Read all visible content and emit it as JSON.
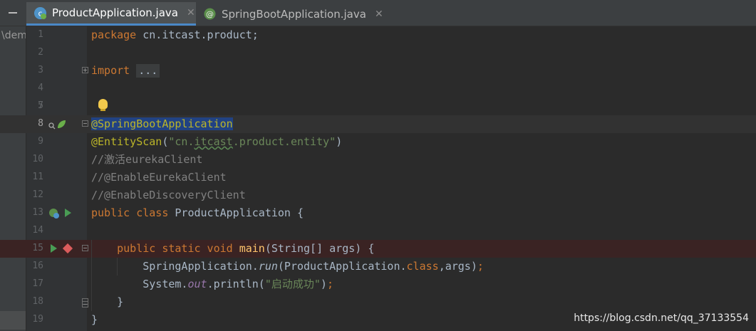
{
  "tabs": [
    {
      "label": "ProductApplication.java",
      "close": "✕",
      "icon": "spring-class-icon"
    },
    {
      "label": "SpringBootApplication.java",
      "close": "✕",
      "icon": "annotation-icon"
    }
  ],
  "sidebar": {
    "path_label": "\\dem"
  },
  "lines": [
    {
      "num": "1"
    },
    {
      "num": "2"
    },
    {
      "num": "3"
    },
    {
      "num": "4"
    },
    {
      "num": "5"
    },
    {
      "num": "6"
    },
    {
      "num": "7"
    },
    {
      "num": "8"
    },
    {
      "num": "9"
    },
    {
      "num": "10"
    },
    {
      "num": "11"
    },
    {
      "num": "12"
    },
    {
      "num": "13"
    },
    {
      "num": "14"
    },
    {
      "num": "15"
    },
    {
      "num": "16"
    },
    {
      "num": "17"
    },
    {
      "num": "18"
    },
    {
      "num": "19"
    }
  ],
  "code": {
    "l1_kw": "package",
    "l1_rest": " cn.itcast.product;",
    "l3_kw": "import",
    "l3_fold": "...",
    "l8_ann": "@SpringBootApplication",
    "l9_ann": "@EntityScan",
    "l9_p1": "(",
    "l9_str_a": "\"cn.",
    "l9_str_b": "itcast",
    "l9_str_c": ".product.entity\"",
    "l9_p2": ")",
    "l10": "//激活eurekaClient",
    "l11": "//@EnableEurekaClient",
    "l12": "//@EnableDiscoveryClient",
    "l13_kw": "public class",
    "l13_rest": " ProductApplication {",
    "l15_kw": "public static void",
    "l15_mth": "main",
    "l15_rest": "(String[] args) {",
    "l16_a": "SpringApplication.",
    "l16_run": "run",
    "l16_b": "(ProductApplication.",
    "l16_cls": "class",
    "l16_c": ",args)",
    "l16_semi": ";",
    "l17_a": "System.",
    "l17_out": "out",
    "l17_b": ".println(",
    "l17_str": "\"启动成功\"",
    "l17_c": ")",
    "l17_semi": ";",
    "l18": "}",
    "l19": "}"
  },
  "watermark": "https://blog.csdn.net/qq_37133554",
  "colors": {
    "background": "#2b2b2b",
    "keyword": "#cc7832",
    "annotation": "#bbb529",
    "string": "#6a8759",
    "comment": "#808080",
    "breakpoint": "#db5c5c",
    "run": "#499c54"
  }
}
